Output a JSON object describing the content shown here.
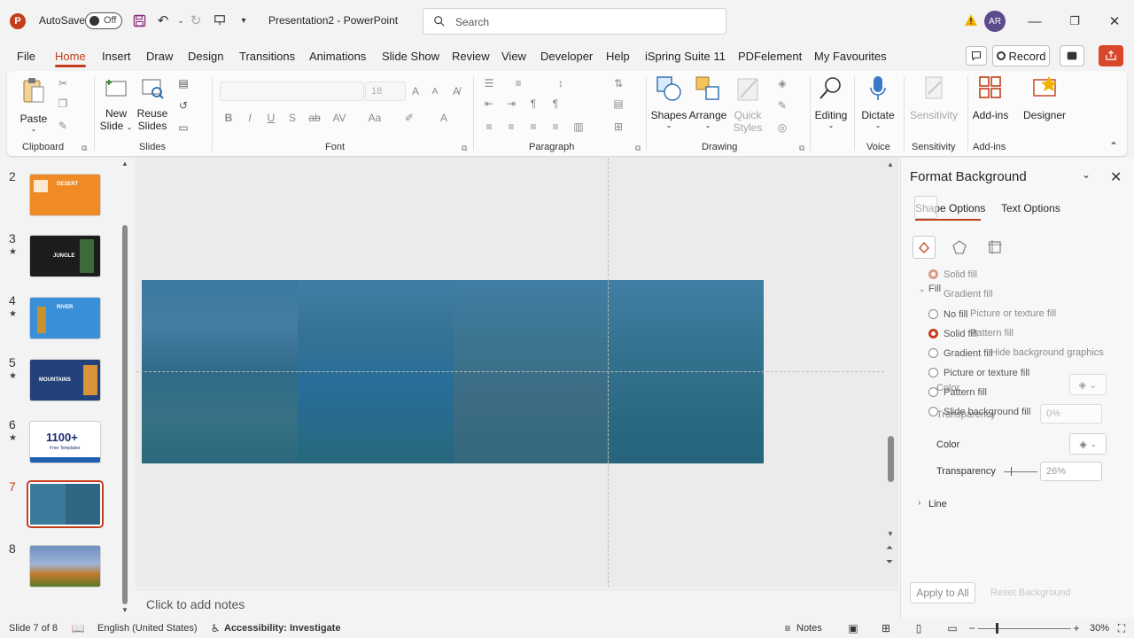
{
  "titlebar": {
    "autosave_label": "AutoSave",
    "autosave_state": "Off",
    "doc_title": "Presentation2 - PowerPoint",
    "search_placeholder": "Search",
    "avatar_initials": "AR",
    "logo_letter": "P"
  },
  "menu": {
    "tabs": [
      "File",
      "Home",
      "Insert",
      "Draw",
      "Design",
      "Transitions",
      "Animations",
      "Slide Show",
      "Review",
      "View",
      "Developer",
      "Help",
      "iSpring Suite 11",
      "PDFelement",
      "My Favourites"
    ],
    "active_tab": "Home",
    "record_label": "Record"
  },
  "ribbon": {
    "paste": "Paste",
    "new_slide": [
      "New",
      "Slide"
    ],
    "reuse_slides": [
      "Reuse",
      "Slides"
    ],
    "font_size": "18",
    "shapes": "Shapes",
    "arrange": "Arrange",
    "quick_styles": [
      "Quick",
      "Styles"
    ],
    "editing": "Editing",
    "dictate": "Dictate",
    "sensitivity": "Sensitivity",
    "addins": "Add-ins",
    "designer": "Designer",
    "groups": {
      "clipboard": "Clipboard",
      "slides": "Slides",
      "font": "Font",
      "paragraph": "Paragraph",
      "drawing": "Drawing",
      "voice": "Voice",
      "sensitivity": "Sensitivity",
      "addins": "Add-ins"
    }
  },
  "thumbnails": [
    {
      "num": "2",
      "star": false,
      "bg": "#f08a24",
      "label": "DESERT"
    },
    {
      "num": "3",
      "star": true,
      "bg": "#1c1c1c",
      "label": "JUNGLE"
    },
    {
      "num": "4",
      "star": true,
      "bg": "#3a8fd9",
      "label": "RIVER"
    },
    {
      "num": "5",
      "star": true,
      "bg": "#24427a",
      "label": "MOUNTAINS"
    },
    {
      "num": "6",
      "star": true,
      "bg": "#ffffff",
      "label": "1100+"
    },
    {
      "num": "7",
      "star": false,
      "bg": "#2f6d8f",
      "label": ""
    },
    {
      "num": "8",
      "star": false,
      "bg": "#6f8fbf",
      "label": ""
    }
  ],
  "thumb6_sub": "Free Templates",
  "notes_placeholder": "Click to add notes",
  "pane": {
    "title": "Format Background",
    "tab_shape": "Shape Options",
    "tab_text": "Text Options",
    "fill_header": "Fill",
    "ghost_options": [
      "Solid fill",
      "Gradient fill",
      "Picture or texture fill",
      "Pattern fill",
      "Hide background graphics"
    ],
    "options": [
      "No fill",
      "Solid fill",
      "Gradient fill",
      "Picture or texture fill",
      "Pattern fill",
      "Slide background fill"
    ],
    "ghost_color": "Color",
    "ghost_transparency": "Transparency",
    "ghost_transparency_value": "0%",
    "color_label": "Color",
    "transparency_label": "Transparency",
    "transparency_value": "26%",
    "line_label": "Line",
    "apply_all": "Apply to All",
    "reset": "Reset Background"
  },
  "status": {
    "slide_info": "Slide 7 of 8",
    "language": "English (United States)",
    "accessibility": "Accessibility: Investigate",
    "notes": "Notes",
    "zoom": "30%"
  },
  "colors": {
    "accent": "#c43e1c",
    "overlay": "#1f6896"
  }
}
